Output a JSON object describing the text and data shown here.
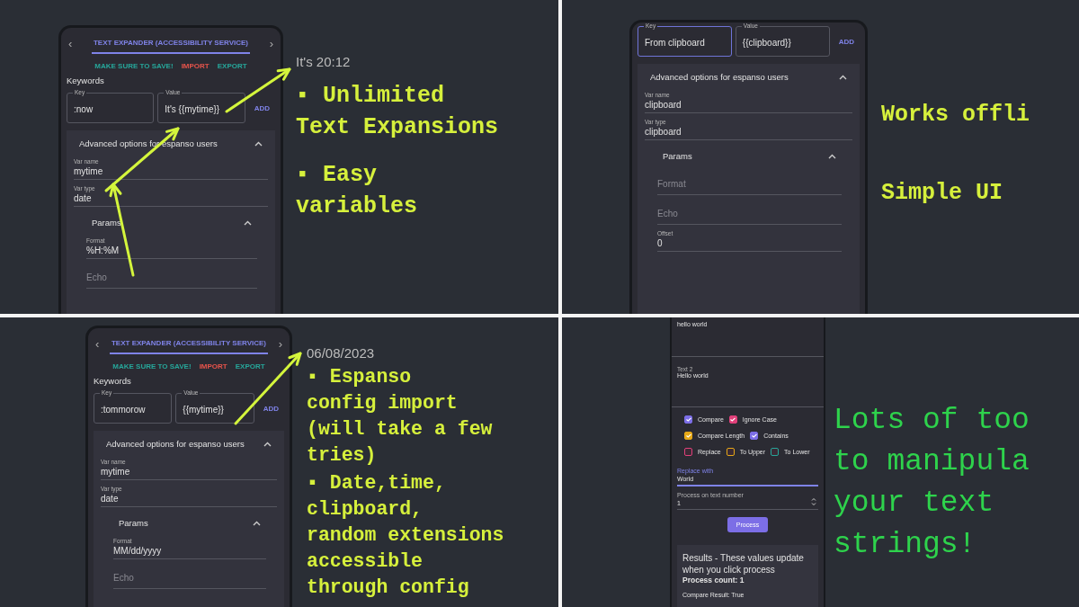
{
  "panels": [
    {
      "phone": {
        "kind": "expander",
        "tab_title": "TEXT EXPANDER (ACCESSIBILITY SERVICE)",
        "prev_icon": "‹",
        "next_icon": "›",
        "actions": [
          {
            "label": "MAKE SURE TO SAVE!",
            "color": "#26a69a"
          },
          {
            "label": "IMPORT",
            "color": "#e5534b"
          },
          {
            "label": "EXPORT",
            "color": "#26a69a"
          }
        ],
        "keywords_label": "Keywords",
        "key_field": {
          "label": "Key",
          "value": ":now",
          "focused": false
        },
        "value_field": {
          "label": "Value",
          "value": "It's {{mytime}}",
          "focused": false
        },
        "add_label": "ADD",
        "advanced": {
          "title": "Advanced options for espanso users",
          "expanded": true,
          "fields": [
            {
              "label": "Var name",
              "value": "mytime"
            },
            {
              "label": "Var type",
              "value": "date"
            }
          ],
          "params": {
            "title": "Params",
            "expanded": true,
            "fields": [
              {
                "label": "Format",
                "value": "%H:%M"
              },
              {
                "placeholder": "Echo"
              }
            ]
          }
        }
      },
      "annotations": [
        {
          "kind": "caption",
          "text": "It's 20:12"
        },
        {
          "kind": "bullet",
          "text": "▪ Unlimited\nText Expansions"
        },
        {
          "kind": "bullet",
          "text": "▪ Easy\nvariables"
        }
      ]
    },
    {
      "phone": {
        "kind": "expander",
        "key_field": {
          "label": "Key",
          "value": "From clipboard",
          "focused": true
        },
        "value_field": {
          "label": "Value",
          "value": "{{clipboard}}",
          "focused": false
        },
        "add_label": "ADD",
        "advanced": {
          "title": "Advanced options for espanso users",
          "expanded": true,
          "fields": [
            {
              "label": "Var name",
              "value": "clipboard"
            },
            {
              "label": "Var type",
              "value": "clipboard"
            }
          ],
          "params": {
            "title": "Params",
            "expanded": true,
            "fields": [
              {
                "placeholder": "Format"
              },
              {
                "placeholder": "Echo"
              },
              {
                "label": "Offset",
                "value": "0"
              }
            ]
          }
        }
      },
      "annotations": [
        {
          "kind": "bullet",
          "text": "Works offli"
        },
        {
          "kind": "bullet",
          "text": "Simple UI"
        }
      ]
    },
    {
      "phone": {
        "kind": "expander",
        "tab_title": "TEXT EXPANDER (ACCESSIBILITY SERVICE)",
        "prev_icon": "‹",
        "next_icon": "›",
        "actions": [
          {
            "label": "MAKE SURE TO SAVE!",
            "color": "#26a69a"
          },
          {
            "label": "IMPORT",
            "color": "#e5534b"
          },
          {
            "label": "EXPORT",
            "color": "#26a69a"
          }
        ],
        "keywords_label": "Keywords",
        "key_field": {
          "label": "Key",
          "value": ":tommorow",
          "focused": false
        },
        "value_field": {
          "label": "Value",
          "value": "{{mytime}}",
          "focused": false
        },
        "add_label": "ADD",
        "advanced": {
          "title": "Advanced options for espanso users",
          "expanded": true,
          "fields": [
            {
              "label": "Var name",
              "value": "mytime"
            },
            {
              "label": "Var type",
              "value": "date"
            }
          ],
          "params": {
            "title": "Params",
            "expanded": true,
            "fields": [
              {
                "label": "Format",
                "value": "MM/dd/yyyy"
              },
              {
                "placeholder": "Echo"
              }
            ]
          }
        }
      },
      "annotations": [
        {
          "kind": "caption",
          "text": "06/08/2023"
        },
        {
          "kind": "bullet",
          "text": "▪ Espanso\nconfig import\n(will take a few\ntries)"
        },
        {
          "kind": "bullet",
          "text": "▪ Date,time,\nclipboard,\nrandom extensions\naccessible\nthrough config"
        }
      ]
    },
    {
      "phone": {
        "kind": "tools",
        "textareas": [
          {
            "value": "hello world"
          },
          {
            "label": "Text 2",
            "value": "Hello world"
          }
        ],
        "checkboxes": [
          {
            "label": "Compare",
            "checked": true,
            "color": "#7c6ee6"
          },
          {
            "label": "Ignore Case",
            "checked": true,
            "color": "#e0407a"
          },
          {
            "label": "Compare Length",
            "checked": true,
            "color": "#e6a817"
          },
          {
            "label": "Contains",
            "checked": true,
            "color": "#7c6ee6"
          },
          {
            "label": "Replace",
            "checked": false,
            "color": "#e0407a"
          },
          {
            "label": "To Upper",
            "checked": false,
            "color": "#e6a817"
          },
          {
            "label": "To Lower",
            "checked": false,
            "color": "#26a69a"
          }
        ],
        "replace_field": {
          "label": "Replace with",
          "value": "World",
          "focused": true
        },
        "number_field": {
          "label": "Process on text number",
          "value": "1"
        },
        "button": "Process",
        "results": {
          "title": "Results - These values update when you click process",
          "count": "Process count: 1",
          "lines": [
            "Compare Result: True"
          ]
        }
      },
      "annotations": [
        {
          "kind": "green",
          "text": "Lots of too\nto manipula\nyour text\nstrings!"
        }
      ]
    }
  ]
}
